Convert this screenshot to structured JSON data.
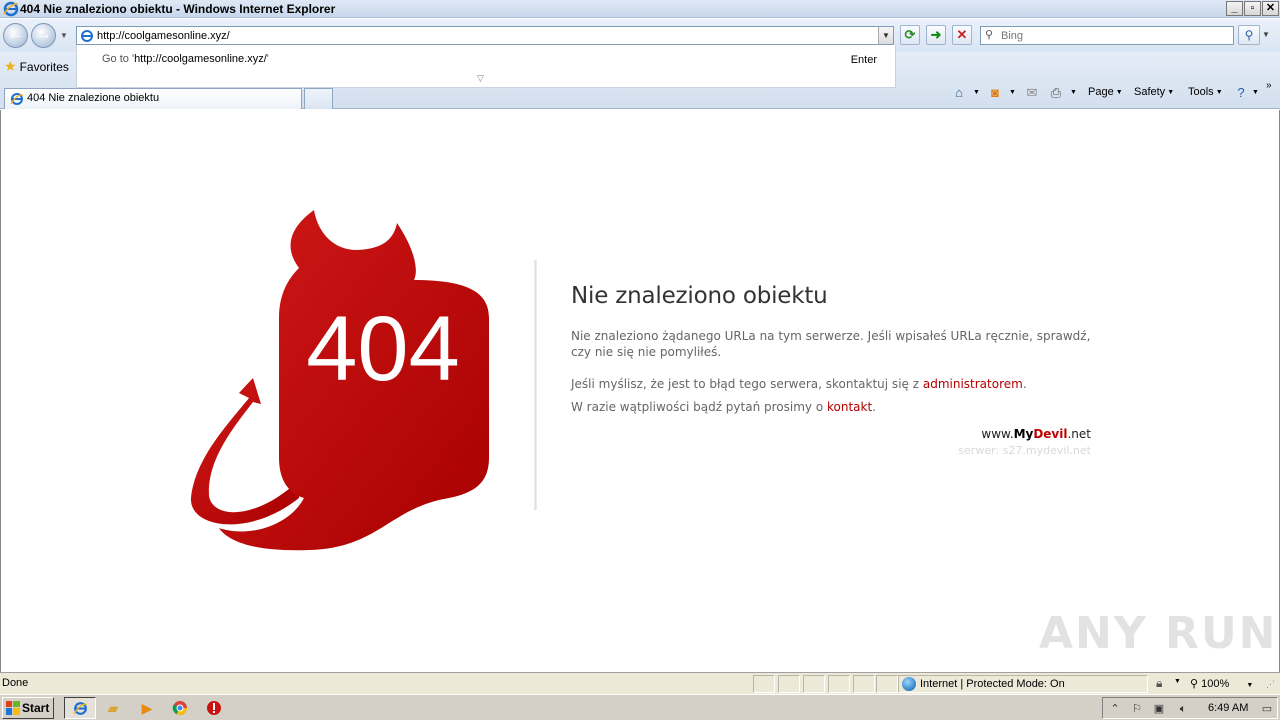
{
  "window": {
    "title": "404 Nie znaleziono obiektu - Windows Internet Explorer"
  },
  "navbar": {
    "address": "http://coolgamesonline.xyz/",
    "search_placeholder": "Bing"
  },
  "autocomplete": {
    "goto_prefix": "Go to '",
    "goto_url": "http://coolgamesonline.xyz/",
    "goto_suffix": "'",
    "enter_label": "Enter"
  },
  "favbar": {
    "favorites_label": "Favorites",
    "tab_title": "404 Nie znalezione obiektu",
    "commands": {
      "page": "Page",
      "safety": "Safety",
      "tools": "Tools"
    }
  },
  "page": {
    "error_code": "404",
    "heading": "Nie znaleziono obiektu",
    "para1": "Nie znaleziono żądanego URLa na tym serwerze. Jeśli wpisałeś URLa ręcznie, sprawdź, czy nie się nie pomyliłeś.",
    "para2_text": "Jeśli myślisz, że jest to błąd tego serwera, skontaktuj się z ",
    "para2_link": "administratorem",
    "para2_end": ".",
    "para3_text": "W razie wątpliwości bądź pytań prosimy o ",
    "para3_link": "kontakt",
    "para3_end": ".",
    "brand_www": "www.",
    "brand_my": "My",
    "brand_devil": "Devil",
    "brand_net": ".net",
    "server": "serwer: s27.mydevil.net",
    "accent_color": "#b30000"
  },
  "statusbar": {
    "status": "Done",
    "zone": "Internet | Protected Mode: On",
    "zoom": "100%"
  },
  "taskbar": {
    "start_label": "Start",
    "clock": "6:49 AM"
  },
  "watermark": "ANY RUN"
}
